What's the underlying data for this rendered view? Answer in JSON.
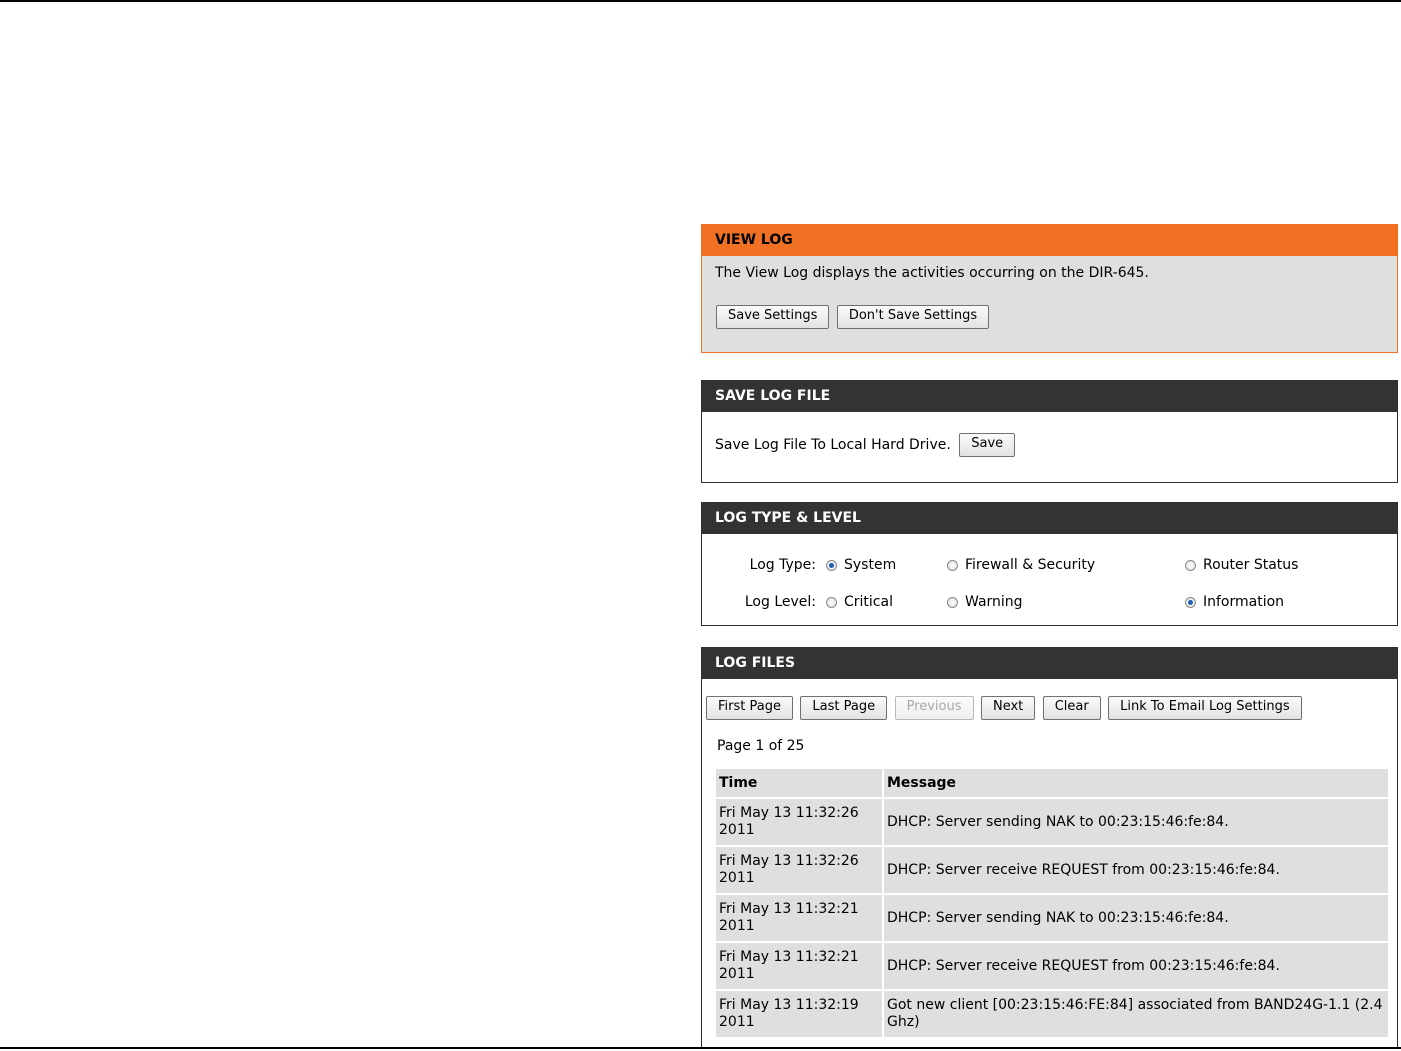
{
  "view_log": {
    "title": "VIEW LOG",
    "description": "The View Log displays the activities occurring on the DIR-645.",
    "save_settings": "Save Settings",
    "dont_save_settings": "Don't Save Settings"
  },
  "save_log_file": {
    "title": "SAVE LOG FILE",
    "label": "Save Log File To Local Hard Drive.",
    "save": "Save"
  },
  "log_type_level": {
    "title": "LOG TYPE & LEVEL",
    "type_label": "Log Type:",
    "types": [
      "System",
      "Firewall & Security",
      "Router Status"
    ],
    "type_selected": "System",
    "level_label": "Log Level:",
    "levels": [
      "Critical",
      "Warning",
      "Information"
    ],
    "level_selected": "Information"
  },
  "log_files": {
    "title": "LOG FILES",
    "buttons": {
      "first_page": "First Page",
      "last_page": "Last Page",
      "previous": "Previous",
      "next": "Next",
      "clear": "Clear",
      "email": "Link To Email Log Settings"
    },
    "page_info": "Page 1 of 25",
    "columns": [
      "Time",
      "Message"
    ],
    "rows": [
      {
        "time": "Fri May 13 11:32:26 2011",
        "message": "DHCP: Server sending NAK to 00:23:15:46:fe:84."
      },
      {
        "time": "Fri May 13 11:32:26 2011",
        "message": "DHCP: Server receive REQUEST from 00:23:15:46:fe:84."
      },
      {
        "time": "Fri May 13 11:32:21 2011",
        "message": "DHCP: Server sending NAK to 00:23:15:46:fe:84."
      },
      {
        "time": "Fri May 13 11:32:21 2011",
        "message": "DHCP: Server receive REQUEST from 00:23:15:46:fe:84."
      },
      {
        "time": "Fri May 13 11:32:19 2011",
        "message": "Got new client [00:23:15:46:FE:84] associated from BAND24G-1.1 (2.4 Ghz)"
      }
    ]
  },
  "colors": {
    "accent_orange": "#f07124",
    "header_dark": "#333333",
    "panel_gray": "#dfdfdf",
    "radio_selected": "#1e5fb4"
  }
}
